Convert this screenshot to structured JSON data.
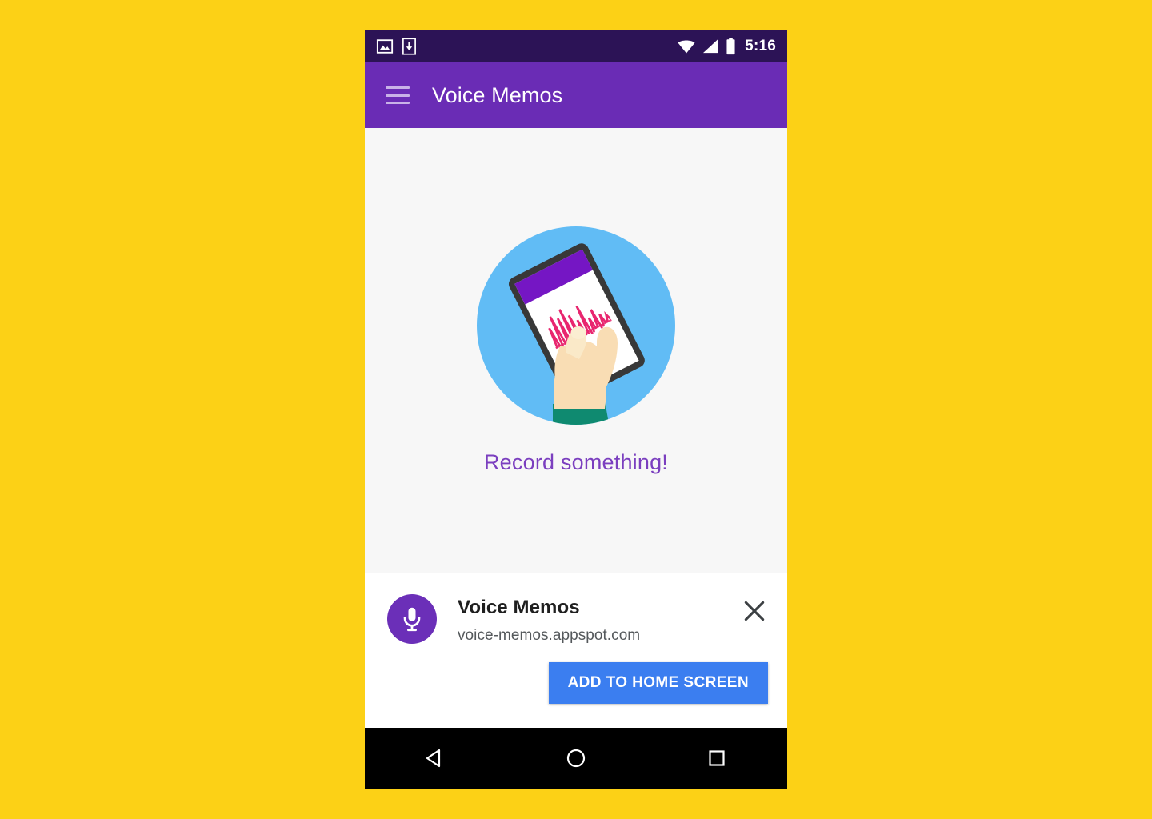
{
  "page": {
    "background_color": "#fcd116"
  },
  "status_bar": {
    "background_color": "#2c1356",
    "left_icons": [
      "image-icon",
      "download-icon"
    ],
    "right_icons": [
      "wifi-icon",
      "cellular-signal-icon",
      "battery-icon"
    ],
    "clock": "5:16"
  },
  "app_bar": {
    "background_color": "#6a2cb5",
    "menu_icon": "hamburger-menu-icon",
    "title": "Voice Memos"
  },
  "content": {
    "background_color": "#f7f7f7",
    "illustration": "hand-holding-phone-recording-illustration",
    "empty_state_text": "Record something!",
    "empty_state_color": "#7b3fbf"
  },
  "install_banner": {
    "app_icon": "microphone-icon",
    "app_icon_color": "#6b2fb8",
    "app_name": "Voice Memos",
    "url": "voice-memos.appspot.com",
    "close_icon": "close-x-icon",
    "add_button_label": "ADD TO HOME SCREEN",
    "add_button_color": "#3b7ef0"
  },
  "nav_bar": {
    "background_color": "#000000",
    "buttons": [
      {
        "name": "back",
        "icon": "back-triangle-icon"
      },
      {
        "name": "home",
        "icon": "home-circle-icon"
      },
      {
        "name": "recents",
        "icon": "recents-square-icon"
      }
    ]
  }
}
